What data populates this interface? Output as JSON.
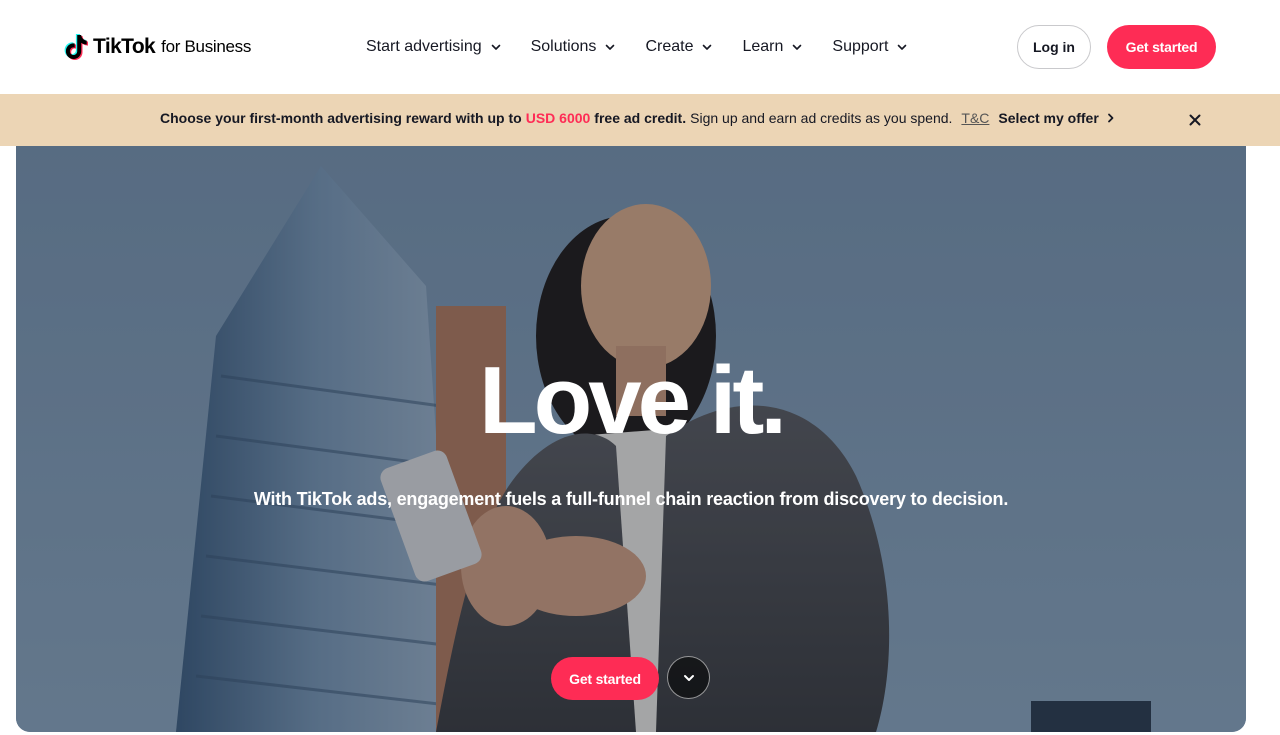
{
  "header": {
    "logo": {
      "brand": "TikTok",
      "sub": "for Business",
      "icon": "tiktok-note-icon"
    },
    "nav": [
      {
        "label": "Start advertising",
        "icon": "chevron-down-icon"
      },
      {
        "label": "Solutions",
        "icon": "chevron-down-icon"
      },
      {
        "label": "Create",
        "icon": "chevron-down-icon"
      },
      {
        "label": "Learn",
        "icon": "chevron-down-icon"
      },
      {
        "label": "Support",
        "icon": "chevron-down-icon"
      }
    ],
    "login_label": "Log in",
    "cta_label": "Get started"
  },
  "banner": {
    "lead": "Choose your first-month advertising reward with up to",
    "amount": "USD 6000",
    "tail_bold": "free ad credit.",
    "tail": "Sign up and earn ad credits as you spend.",
    "tc": "T&C",
    "offer": "Select my offer",
    "close_icon": "close-icon"
  },
  "hero": {
    "title": "Love it.",
    "subtitle": "With TikTok ads, engagement fuels a full-funnel chain reaction from discovery to decision.",
    "cta_label": "Get started",
    "scroll_icon": "chevron-down-icon"
  },
  "colors": {
    "brand": "#fe2c55",
    "banner_bg": "#ecd5b5",
    "text": "#161823"
  }
}
